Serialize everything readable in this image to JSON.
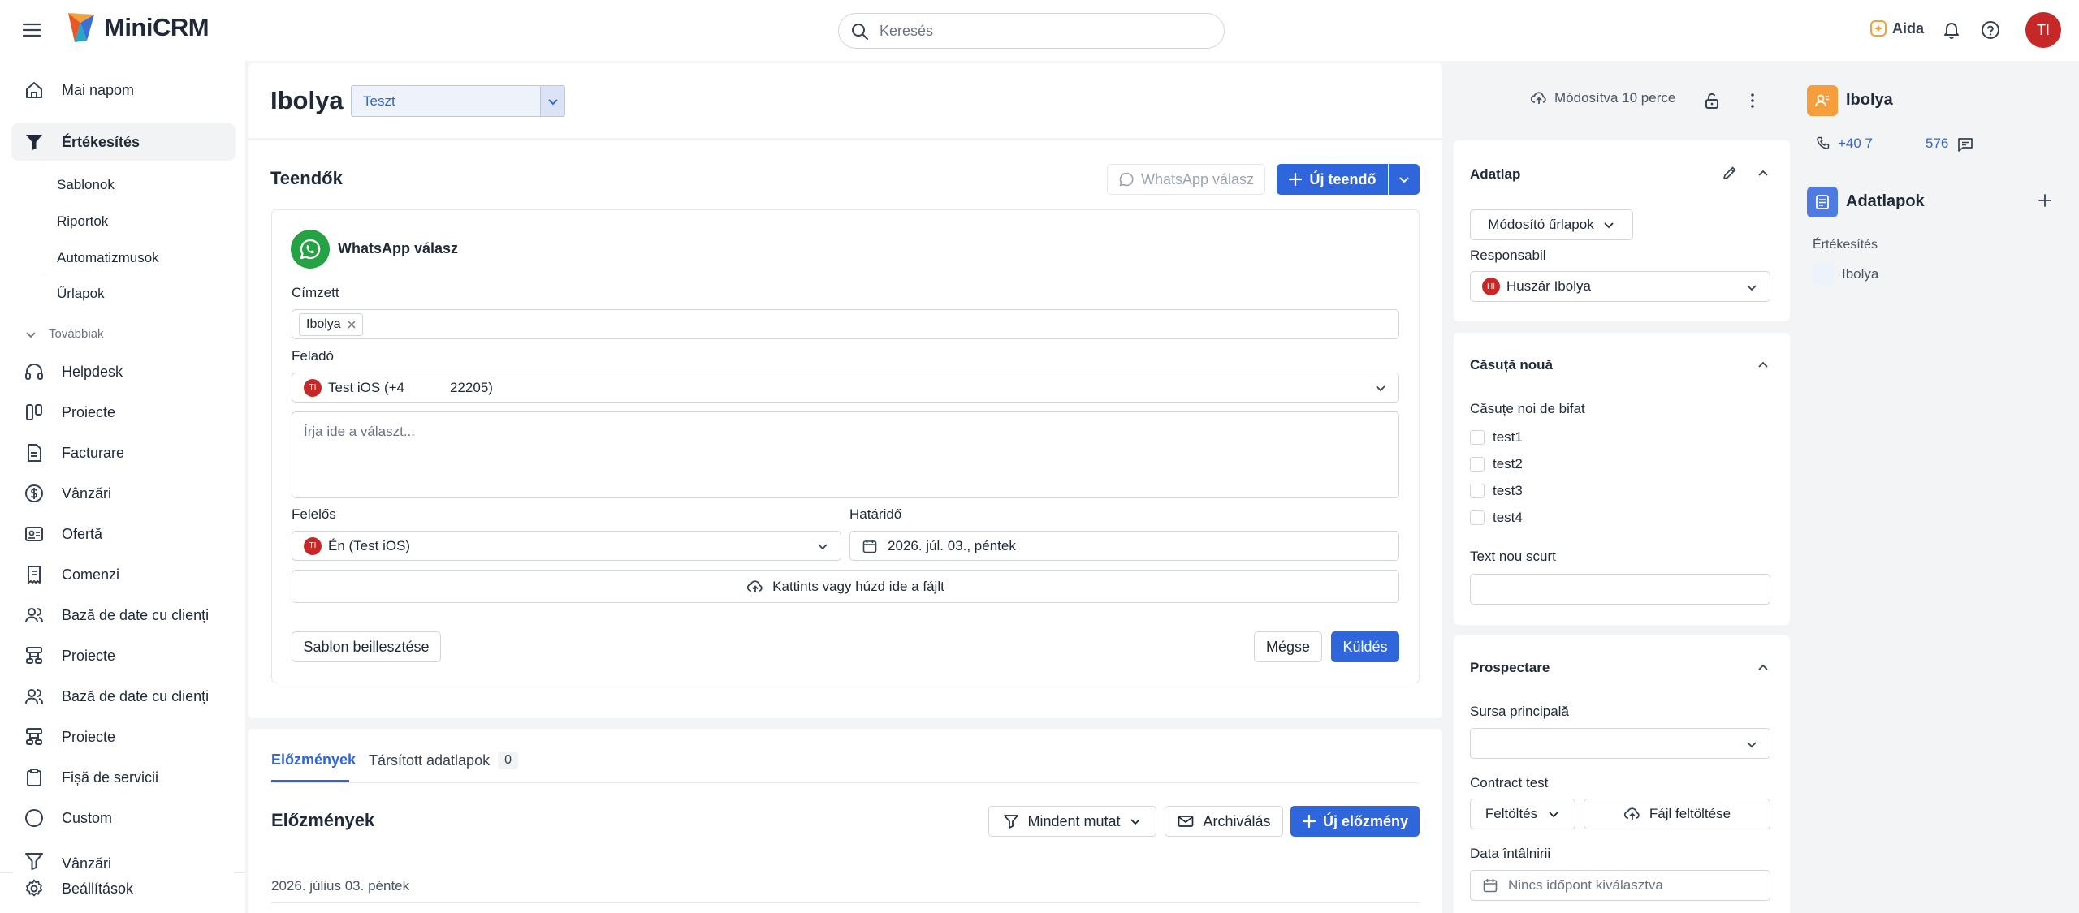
{
  "app": {
    "brand": "MiniCRM"
  },
  "search": {
    "placeholder": "Keresés"
  },
  "topbar": {
    "aida_label": "Aida",
    "avatar_initials": "TI"
  },
  "sidebar": {
    "items": [
      {
        "label": "Mai napom"
      },
      {
        "label": "Értékesítés"
      },
      {
        "label": "Helpdesk"
      },
      {
        "label": "Proiecte"
      },
      {
        "label": "Facturare"
      },
      {
        "label": "Vânzări"
      },
      {
        "label": "Ofertă"
      },
      {
        "label": "Comenzi"
      },
      {
        "label": "Bază de date cu clienți"
      },
      {
        "label": "Proiecte"
      },
      {
        "label": "Bază de date cu clienți"
      },
      {
        "label": "Proiecte"
      },
      {
        "label": "Fișă de servicii"
      },
      {
        "label": "Custom"
      },
      {
        "label": "Vânzări"
      },
      {
        "label": "Beállítások"
      }
    ],
    "subitems": [
      "Sablonok",
      "Riportok",
      "Automatizmusok",
      "Űrlapok"
    ],
    "more_label": "Továbbiak"
  },
  "record": {
    "title": "Ibolya",
    "status_select": "Teszt",
    "modified": "Módosítva 10 perce"
  },
  "tasks": {
    "title": "Teendők",
    "whatsapp_reply_button": "WhatsApp válasz",
    "new_task_button": "Új teendő",
    "composer": {
      "title": "WhatsApp válasz",
      "recipient_label": "Címzett",
      "recipient_chip": "Ibolya",
      "sender_label": "Feladó",
      "sender_avatar": "TI",
      "sender_prefix": "Test iOS (+4",
      "sender_suffix": "22205)",
      "message_placeholder": "Írja ide a választ...",
      "owner_label": "Felelős",
      "owner_avatar": "TI",
      "owner_value": "Én (Test iOS)",
      "deadline_label": "Határidő",
      "deadline_value": "2026. júl. 03., péntek",
      "upload_text": "Kattints vagy húzd ide a fájlt",
      "template_button": "Sablon beillesztése",
      "cancel_button": "Mégse",
      "send_button": "Küldés"
    }
  },
  "history": {
    "tab_history": "Előzmények",
    "tab_linked": "Társított adatlapok",
    "tab_linked_count": "0",
    "title": "Előzmények",
    "filter_button": "Mindent mutat",
    "archive_button": "Archiválás",
    "new_button": "Új előzmény",
    "date_header": "2026. július 03. péntek"
  },
  "datasheet": {
    "title": "Adatlap",
    "forms_dropdown": "Módosító űrlapok",
    "responsible_label": "Responsabil",
    "responsible_avatar": "HI",
    "responsible_value": "Huszár Ibolya"
  },
  "new_box": {
    "title": "Căsuță nouă",
    "checkboxes_label": "Căsuțe noi de bifat",
    "options": [
      "test1",
      "test2",
      "test3",
      "test4"
    ],
    "short_text_label": "Text nou scurt"
  },
  "prospecting": {
    "title": "Prospectare",
    "main_source_label": "Sursa principală",
    "contract_label": "Contract test",
    "upload_dropdown": "Feltöltés",
    "file_upload_button": "Fájl feltöltése",
    "meeting_date_label": "Data întâlnirii",
    "no_time_selected": "Nincs időpont kiválasztva"
  },
  "contact": {
    "name": "Ibolya",
    "phone_prefix": "+40 7",
    "phone_suffix": "576",
    "sheets_title": "Adatlapok",
    "sheets_category": "Értékesítés",
    "sheets_item": "Ibolya"
  },
  "colors": {
    "primary": "#2f66db",
    "avatar_red": "#c62828",
    "whatsapp_green": "#25a244",
    "contact_orange": "#f59e3b",
    "sheets_blue": "#4f7ae0"
  }
}
